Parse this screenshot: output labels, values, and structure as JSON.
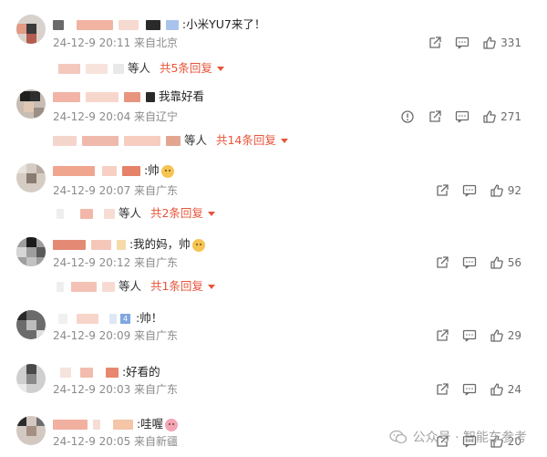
{
  "comments": [
    {
      "text": ":小米YU7来了！",
      "meta": "24-12-9 20:11 来自北京",
      "likes": "331",
      "reply_suffix": "等人",
      "reply_more": "共5条回复",
      "badge": ""
    },
    {
      "text": "我靠好看",
      "meta": "24-12-9 20:04 来自辽宁",
      "likes": "271",
      "reply_suffix": "等人",
      "reply_more": "共14条回复",
      "badge": ""
    },
    {
      "text": ":帅",
      "meta": "24-12-9 20:07 来自广东",
      "likes": "92",
      "reply_suffix": "等人",
      "reply_more": "共2条回复",
      "badge": ""
    },
    {
      "text": ":我的妈，帅",
      "meta": "24-12-9 20:12 来自广东",
      "likes": "56",
      "reply_suffix": "等人",
      "reply_more": "共1条回复",
      "badge": ""
    },
    {
      "text": ":帅！",
      "meta": "24-12-9 20:09 来自广东",
      "likes": "29",
      "badge": "4"
    },
    {
      "text": ":好看的",
      "meta": "24-12-9 20:03 来自广东",
      "likes": "24",
      "badge": ""
    },
    {
      "text": ":哇喔",
      "meta": "24-12-9 20:05 来自新疆",
      "likes": "20",
      "badge": ""
    }
  ],
  "watermark": {
    "text": "公众号 · 智能车参考"
  },
  "colors": {
    "accent": "#e8543a",
    "meta": "#8b8b8b",
    "icon": "#6b6b6b"
  },
  "icons": [
    "share-icon",
    "comment-icon",
    "like-icon",
    "report-icon",
    "chevron-down-icon",
    "wechat-icon"
  ]
}
